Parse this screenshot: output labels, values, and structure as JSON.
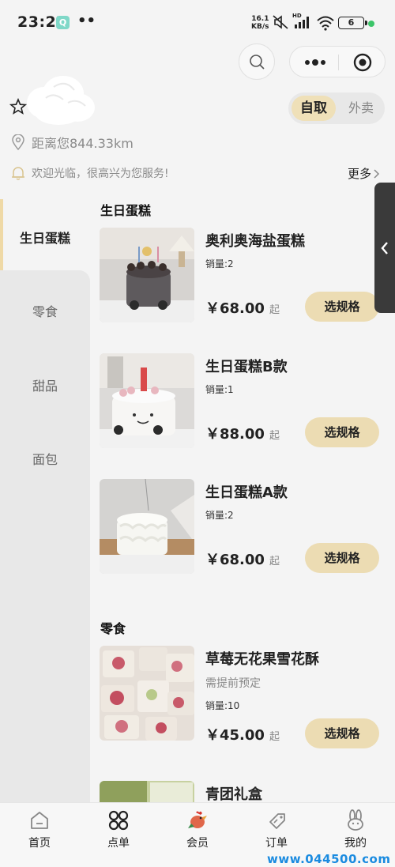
{
  "status_bar": {
    "time": "23:27",
    "app_badge": "Q",
    "dots": "••",
    "net_speed_value": "16.1",
    "net_speed_unit": "KB/s",
    "signal_label": "HD",
    "battery_level": "6"
  },
  "header": {
    "pickup_label": "自取",
    "delivery_label": "外卖",
    "distance": "距离您844.33km",
    "notice": "欢迎光临，很高兴为您服务!",
    "more_label": "更多"
  },
  "categories": [
    {
      "label": "生日蛋糕",
      "active": true
    },
    {
      "label": "零食",
      "active": false
    },
    {
      "label": "甜品",
      "active": false
    },
    {
      "label": "面包",
      "active": false
    }
  ],
  "sections": [
    {
      "title": "生日蛋糕",
      "products": [
        {
          "name": "奥利奥海盐蛋糕",
          "note": "",
          "sales": "销量:2",
          "price": "￥68.00",
          "from": "起",
          "button": "选规格"
        },
        {
          "name": "生日蛋糕B款",
          "note": "",
          "sales": "销量:1",
          "price": "￥88.00",
          "from": "起",
          "button": "选规格"
        },
        {
          "name": "生日蛋糕A款",
          "note": "",
          "sales": "销量:2",
          "price": "￥68.00",
          "from": "起",
          "button": "选规格"
        }
      ]
    },
    {
      "title": "零食",
      "products": [
        {
          "name": "草莓无花果雪花酥",
          "note": "需提前预定",
          "sales": "销量:10",
          "price": "￥45.00",
          "from": "起",
          "button": "选规格"
        },
        {
          "name": "青团礼盒",
          "note": "",
          "sales": "",
          "price": "",
          "from": "",
          "button": ""
        }
      ]
    }
  ],
  "bottom_nav": [
    {
      "label": "首页",
      "icon": "home-icon"
    },
    {
      "label": "点单",
      "icon": "order-grid-icon"
    },
    {
      "label": "会员",
      "icon": "member-rooster-icon"
    },
    {
      "label": "订单",
      "icon": "ticket-tag-icon"
    },
    {
      "label": "我的",
      "icon": "rabbit-profile-icon"
    }
  ],
  "watermark": "www.044500.com",
  "colors": {
    "accent": "#ecdcb3",
    "background": "#f4f4f4",
    "category_panel": "#e8e8e8",
    "side_tab": "#3a3a3a",
    "watermark": "#1a8be0"
  }
}
